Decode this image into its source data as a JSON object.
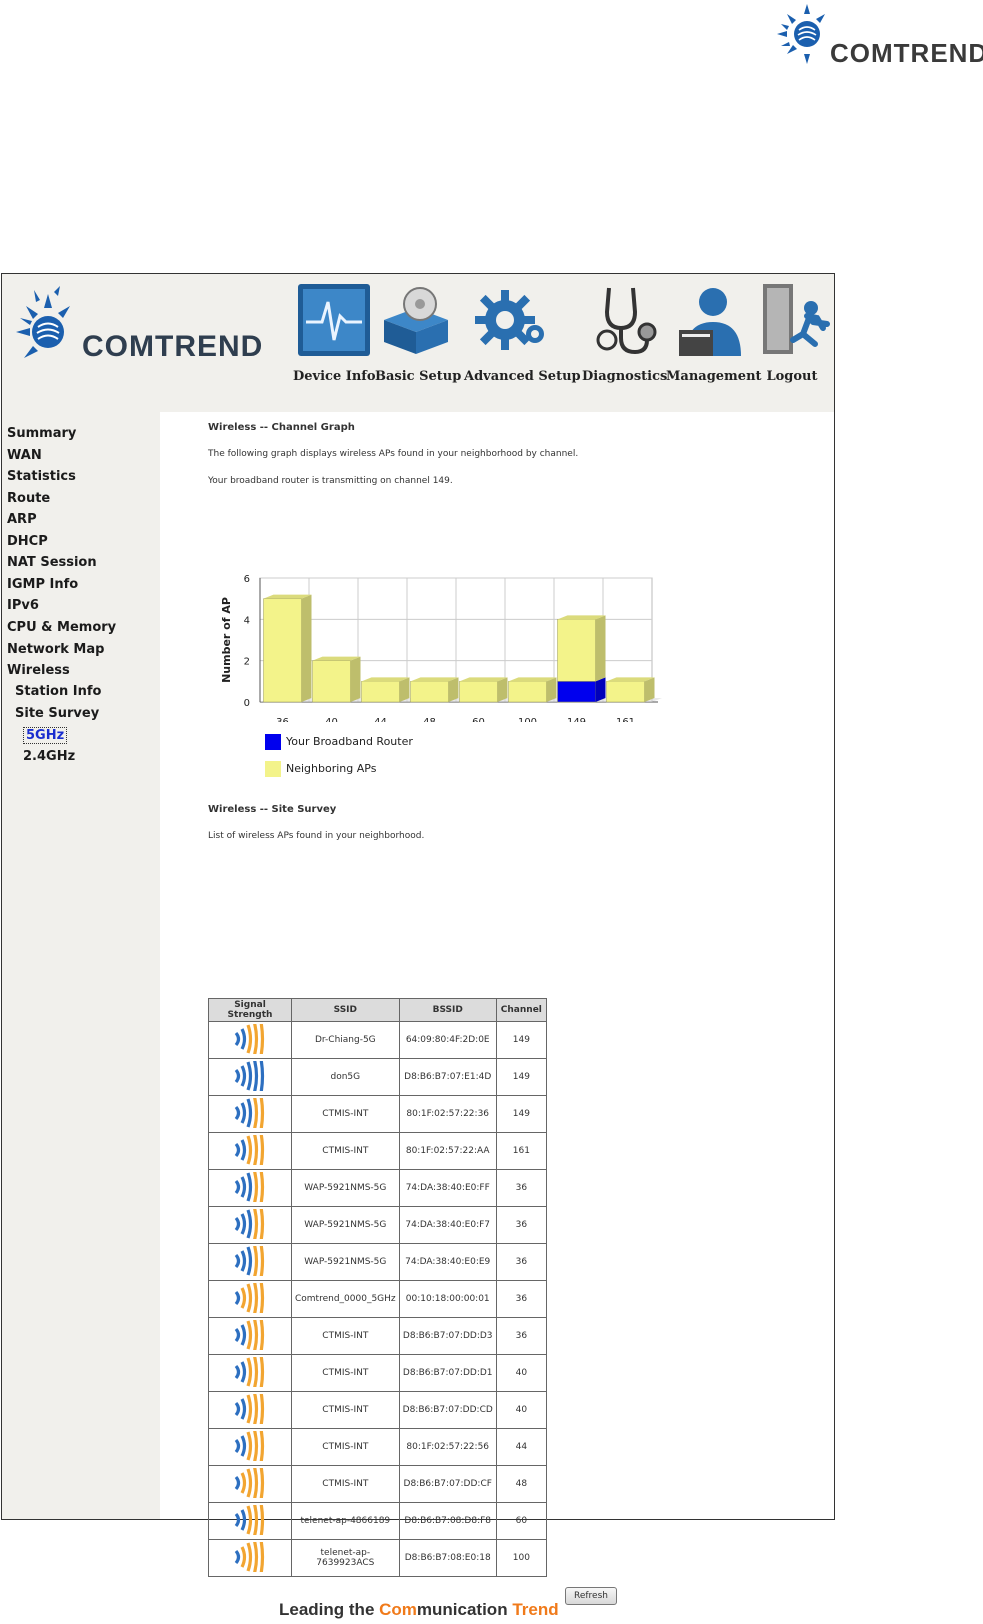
{
  "brand": {
    "name": "COMTREND"
  },
  "nav": [
    {
      "id": "device-info",
      "label": "Device Info"
    },
    {
      "id": "basic-setup",
      "label": "Basic Setup"
    },
    {
      "id": "advanced-setup",
      "label": "Advanced Setup"
    },
    {
      "id": "diagnostics",
      "label": "Diagnostics"
    },
    {
      "id": "management",
      "label": "Management"
    },
    {
      "id": "logout",
      "label": "Logout"
    }
  ],
  "sidebar": [
    {
      "label": "Summary",
      "level": 0
    },
    {
      "label": "WAN",
      "level": 0
    },
    {
      "label": "Statistics",
      "level": 0
    },
    {
      "label": "Route",
      "level": 0
    },
    {
      "label": "ARP",
      "level": 0
    },
    {
      "label": "DHCP",
      "level": 0
    },
    {
      "label": "NAT Session",
      "level": 0
    },
    {
      "label": "IGMP Info",
      "level": 0
    },
    {
      "label": "IPv6",
      "level": 0
    },
    {
      "label": "CPU & Memory",
      "level": 0
    },
    {
      "label": "Network Map",
      "level": 0
    },
    {
      "label": "Wireless",
      "level": 0
    },
    {
      "label": "Station Info",
      "level": 1
    },
    {
      "label": "Site Survey",
      "level": 1
    },
    {
      "label": "5GHz",
      "level": 2,
      "active": true
    },
    {
      "label": "2.4GHz",
      "level": 2
    }
  ],
  "graph_section": {
    "title": "Wireless -- Channel Graph",
    "desc": "The following graph displays wireless APs found in your neighborhood by channel.",
    "channel_note": "Your broadband router is transmitting on channel 149."
  },
  "chart_data": {
    "type": "bar",
    "stacked": true,
    "xlabel": "Channel",
    "ylabel": "Number of AP",
    "categories": [
      "36",
      "40",
      "44",
      "48",
      "60",
      "100",
      "149",
      "161"
    ],
    "ylim": [
      0,
      6
    ],
    "yticks": [
      0,
      2,
      4,
      6
    ],
    "grid": true,
    "series": [
      {
        "name": "Your Broadband Router",
        "color": "#0000ee",
        "values": [
          0,
          0,
          0,
          0,
          0,
          0,
          1,
          0
        ]
      },
      {
        "name": "Neighboring APs",
        "color": "#f3f38a",
        "values": [
          5,
          2,
          1,
          1,
          1,
          1,
          3,
          1
        ]
      }
    ]
  },
  "legend": [
    {
      "label": "Your Broadband Router",
      "color": "#0000ee"
    },
    {
      "label": "Neighboring APs",
      "color": "#f3f38a"
    }
  ],
  "survey_section": {
    "title": "Wireless -- Site Survey",
    "desc": "List of wireless APs found in your neighborhood.",
    "columns": [
      "Signal Strength",
      "SSID",
      "BSSID",
      "Channel"
    ],
    "rows": [
      {
        "signal": 2,
        "ssid": "Dr-Chiang-5G",
        "bssid": "64:09:80:4F:2D:0E",
        "channel": "149"
      },
      {
        "signal": 5,
        "ssid": "don5G",
        "bssid": "D8:B6:B7:07:E1:4D",
        "channel": "149"
      },
      {
        "signal": 3,
        "ssid": "CTMIS-INT",
        "bssid": "80:1F:02:57:22:36",
        "channel": "149"
      },
      {
        "signal": 2,
        "ssid": "CTMIS-INT",
        "bssid": "80:1F:02:57:22:AA",
        "channel": "161"
      },
      {
        "signal": 3,
        "ssid": "WAP-5921NMS-5G",
        "bssid": "74:DA:38:40:E0:FF",
        "channel": "36"
      },
      {
        "signal": 3,
        "ssid": "WAP-5921NMS-5G",
        "bssid": "74:DA:38:40:E0:F7",
        "channel": "36"
      },
      {
        "signal": 3,
        "ssid": "WAP-5921NMS-5G",
        "bssid": "74:DA:38:40:E0:E9",
        "channel": "36"
      },
      {
        "signal": 1,
        "ssid": "Comtrend_0000_5GHz",
        "bssid": "00:10:18:00:00:01",
        "channel": "36"
      },
      {
        "signal": 2,
        "ssid": "CTMIS-INT",
        "bssid": "D8:B6:B7:07:DD:D3",
        "channel": "36"
      },
      {
        "signal": 2,
        "ssid": "CTMIS-INT",
        "bssid": "D8:B6:B7:07:DD:D1",
        "channel": "40"
      },
      {
        "signal": 2,
        "ssid": "CTMIS-INT",
        "bssid": "D8:B6:B7:07:DD:CD",
        "channel": "40"
      },
      {
        "signal": 2,
        "ssid": "CTMIS-INT",
        "bssid": "80:1F:02:57:22:56",
        "channel": "44"
      },
      {
        "signal": 1,
        "ssid": "CTMIS-INT",
        "bssid": "D8:B6:B7:07:DD:CF",
        "channel": "48"
      },
      {
        "signal": 2,
        "ssid": "telenet-ap-4866189",
        "bssid": "D8:B6:B7:08:D8:F8",
        "channel": "60"
      },
      {
        "signal": 1,
        "ssid": "telenet-ap-7639923ACS",
        "bssid": "D8:B6:B7:08:E0:18",
        "channel": "100"
      }
    ]
  },
  "refresh_label": "Refresh",
  "footer": {
    "prefix": "Leading the ",
    "co": "Com",
    "mid": "munication ",
    "trend": "Trend"
  }
}
